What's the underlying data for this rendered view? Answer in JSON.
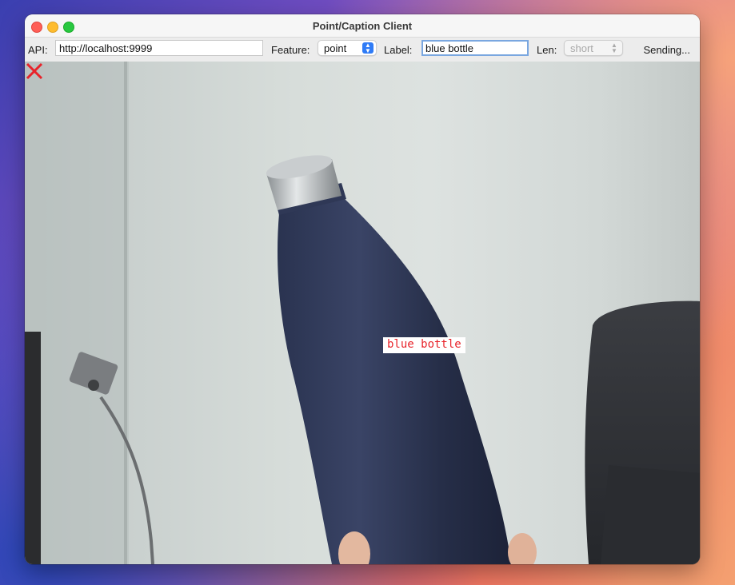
{
  "window": {
    "title": "Point/Caption Client"
  },
  "toolbar": {
    "api_label": "API:",
    "api_value": "http://localhost:9999",
    "feature_label": "Feature:",
    "feature_value": "point",
    "label_label": "Label:",
    "label_value": "blue bottle",
    "len_label": "Len:",
    "len_value": "short",
    "status": "Sending..."
  },
  "overlay": {
    "point_label": "blue bottle",
    "marker_color": "#e8232a"
  },
  "icons": {
    "close": "close-traffic-light",
    "minimize": "minimize-traffic-light",
    "maximize": "maximize-traffic-light",
    "select_arrows": "updown-chevron"
  }
}
